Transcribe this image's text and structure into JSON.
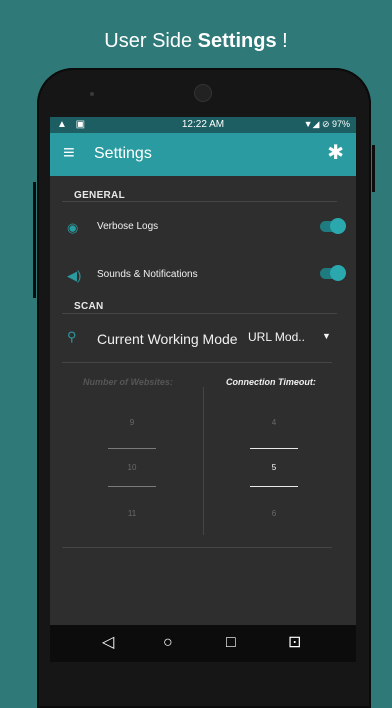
{
  "banner": {
    "prefix": "User Side ",
    "bold": "Settings",
    "suffix": " !"
  },
  "status_bar": {
    "left_icons": "▲ ▣",
    "time": "12:22 AM",
    "right_icons": "▼◢ ⊘ 97%"
  },
  "app_bar": {
    "title": "Settings",
    "menu_icon": "menu-icon",
    "settings_icon": "gear-icon"
  },
  "general": {
    "header": "GENERAL",
    "verbose_logs": {
      "label": "Verbose Logs",
      "enabled": true
    },
    "sounds": {
      "label": "Sounds & Notifications",
      "enabled": true
    }
  },
  "scan": {
    "header": "SCAN",
    "mode_label": "Current Working Mode",
    "mode_value": "URL Mod..",
    "websites": {
      "label": "Number of Websites:",
      "values": [
        "9",
        "10",
        "11"
      ],
      "selected": "10"
    },
    "timeout": {
      "label": "Connection Timeout:",
      "values": [
        "4",
        "5",
        "6"
      ],
      "selected": "5"
    }
  },
  "nav": {
    "back": "◁",
    "home": "○",
    "recents": "□",
    "menu": "⊡"
  },
  "colors": {
    "accent": "#2a9ba0",
    "background": "#2e2e2e",
    "page": "#2f7a78"
  }
}
